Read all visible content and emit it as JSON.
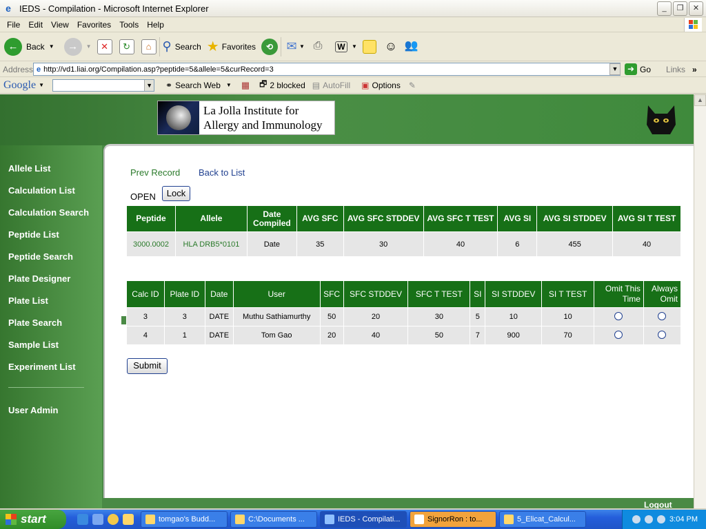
{
  "window": {
    "title": "IEDS - Compilation - Microsoft Internet Explorer"
  },
  "menu": [
    "File",
    "Edit",
    "View",
    "Favorites",
    "Tools",
    "Help"
  ],
  "toolbar": {
    "back": "Back",
    "search": "Search",
    "favorites": "Favorites"
  },
  "address": {
    "label": "Address",
    "url": "http://vd1.liai.org/Compilation.asp?peptide=5&allele=5&curRecord=3",
    "go": "Go",
    "links": "Links"
  },
  "google_bar": {
    "logo": "Google",
    "search_web": "Search Web",
    "blocked": "2 blocked",
    "autofill": "AutoFill",
    "options": "Options"
  },
  "header": {
    "logo_line1": "La Jolla Institute for",
    "logo_line2": "Allergy and Immunology"
  },
  "sidebar": {
    "items": [
      {
        "label": "Allele List"
      },
      {
        "label": "Calculation List"
      },
      {
        "label": "Calculation Search"
      },
      {
        "label": "Peptide List"
      },
      {
        "label": "Peptide Search"
      },
      {
        "label": "Plate Designer"
      },
      {
        "label": "Plate List"
      },
      {
        "label": "Plate Search"
      },
      {
        "label": "Sample List"
      },
      {
        "label": "Experiment List"
      }
    ],
    "admin": "User Admin",
    "logout": "Logout"
  },
  "main": {
    "prev_record": "Prev Record",
    "back_to_list": "Back to List",
    "status": "OPEN",
    "lock": "Lock",
    "summary": {
      "headers": [
        "Peptide",
        "Allele",
        "Date Compiled",
        "AVG SFC",
        "AVG SFC STDDEV",
        "AVG SFC T TEST",
        "AVG SI",
        "AVG SI STDDEV",
        "AVG SI T TEST"
      ],
      "row": {
        "peptide": "3000.0002",
        "allele": "HLA DRB5*0101",
        "date": "Date",
        "avg_sfc": "35",
        "avg_sfc_stddev": "30",
        "avg_sfc_ttest": "40",
        "avg_si": "6",
        "avg_si_stddev": "455",
        "avg_si_ttest": "40"
      }
    },
    "calcs": {
      "headers": [
        "Calc ID",
        "Plate ID",
        "Date",
        "User",
        "SFC",
        "SFC STDDEV",
        "SFC T TEST",
        "SI",
        "SI STDDEV",
        "SI T TEST",
        "Omit This Time",
        "Always Omit"
      ],
      "rows": [
        {
          "calc_id": "3",
          "plate_id": "3",
          "date": "DATE",
          "user": "Muthu Sathiamurthy",
          "sfc": "50",
          "sfc_stddev": "20",
          "sfc_ttest": "30",
          "si": "5",
          "si_stddev": "10",
          "si_ttest": "10"
        },
        {
          "calc_id": "4",
          "plate_id": "1",
          "date": "DATE",
          "user": "Tom Gao",
          "sfc": "20",
          "sfc_stddev": "40",
          "sfc_ttest": "50",
          "si": "7",
          "si_stddev": "900",
          "si_ttest": "70"
        }
      ]
    },
    "submit": "Submit"
  },
  "taskbar": {
    "start": "start",
    "tasks": [
      {
        "label": "tomgao's Budd..."
      },
      {
        "label": "C:\\Documents ..."
      },
      {
        "label": "IEDS - Compilati..."
      },
      {
        "label": "SignorRon : to..."
      },
      {
        "label": "5_Elicat_Calcul..."
      }
    ],
    "clock": "3:04 PM"
  },
  "colors": {
    "header_green": "#177017",
    "sidebar_green": "#4a8a45",
    "link_green": "#2a7a2a",
    "link_blue": "#1f3f8f"
  }
}
